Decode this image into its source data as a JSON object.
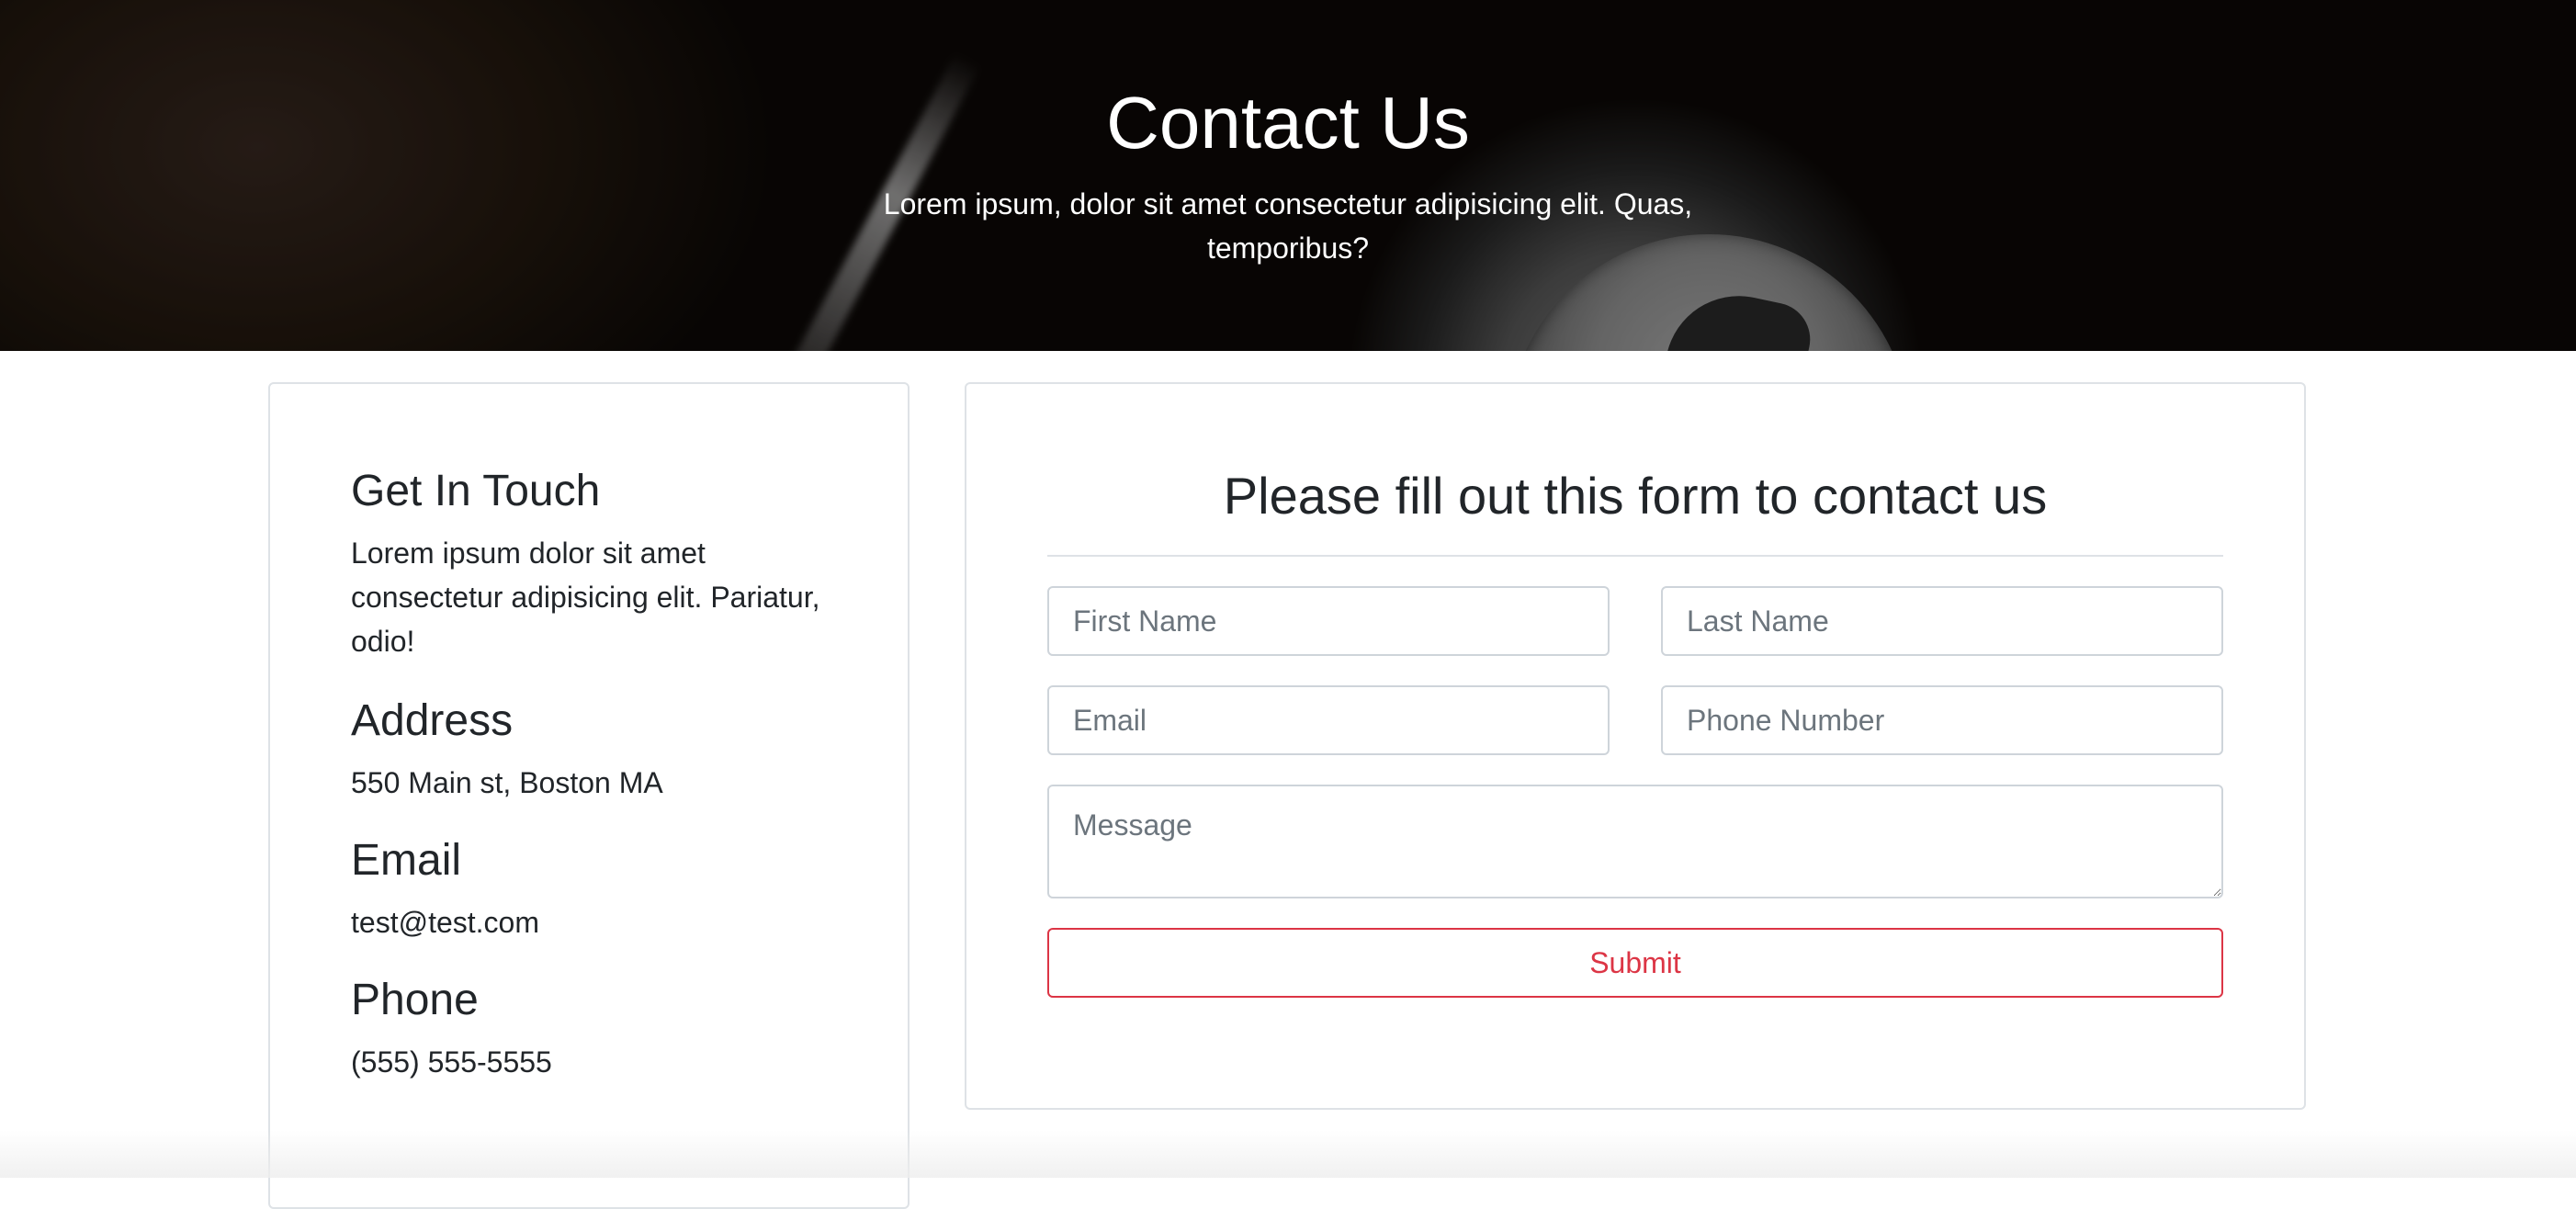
{
  "hero": {
    "title": "Contact Us",
    "subtitle": "Lorem ipsum, dolor sit amet consectetur adipisicing elit. Quas, temporibus?"
  },
  "info": {
    "touch_heading": "Get In Touch",
    "touch_text": "Lorem ipsum dolor sit amet consectetur adipisicing elit. Pariatur, odio!",
    "address_heading": "Address",
    "address_value": "550 Main st, Boston MA",
    "email_heading": "Email",
    "email_value": "test@test.com",
    "phone_heading": "Phone",
    "phone_value": "(555) 555-5555"
  },
  "form": {
    "title": "Please fill out this form to contact us",
    "first_name_placeholder": "First Name",
    "last_name_placeholder": "Last Name",
    "email_placeholder": "Email",
    "phone_placeholder": "Phone Number",
    "message_placeholder": "Message",
    "submit_label": "Submit"
  },
  "colors": {
    "accent_danger": "#dc3545",
    "border": "#dee2e6",
    "text": "#212529"
  }
}
